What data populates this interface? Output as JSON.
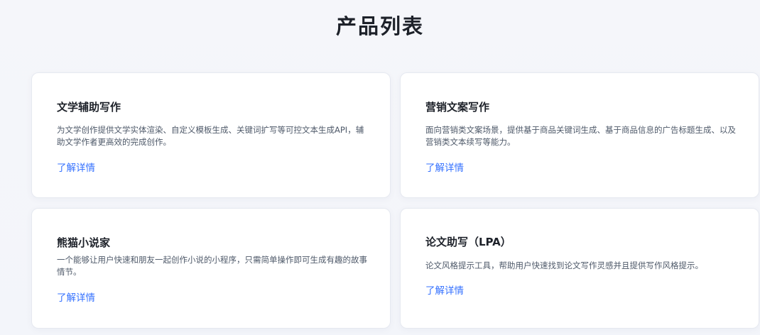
{
  "page": {
    "title": "产品列表"
  },
  "products": [
    {
      "title": "文学辅助写作",
      "description": "为文学创作提供文学实体渲染、自定义模板生成、关键词扩写等可控文本生成API，辅助文学作者更高效的完成创作。",
      "link_label": "了解详情"
    },
    {
      "title": "营销文案写作",
      "description": "面向营销类文案场景，提供基于商品关键词生成、基于商品信息的广告标题生成、以及营销类文本续写等能力。",
      "link_label": "了解详情"
    },
    {
      "title": "熊猫小说家",
      "description": "一个能够让用户快速和朋友一起创作小说的小程序，只需简单操作即可生成有趣的故事情节。",
      "link_label": "了解详情"
    },
    {
      "title": "论文助写（LPA）",
      "description": "论文风格提示工具，帮助用户快速找到论文写作灵感并且提供写作风格提示。",
      "link_label": "了解详情"
    }
  ],
  "colors": {
    "link": "#3370ff",
    "title": "#1d2129",
    "description": "#4e5969",
    "card_background": "#ffffff",
    "page_background": "#f4f6fb"
  }
}
